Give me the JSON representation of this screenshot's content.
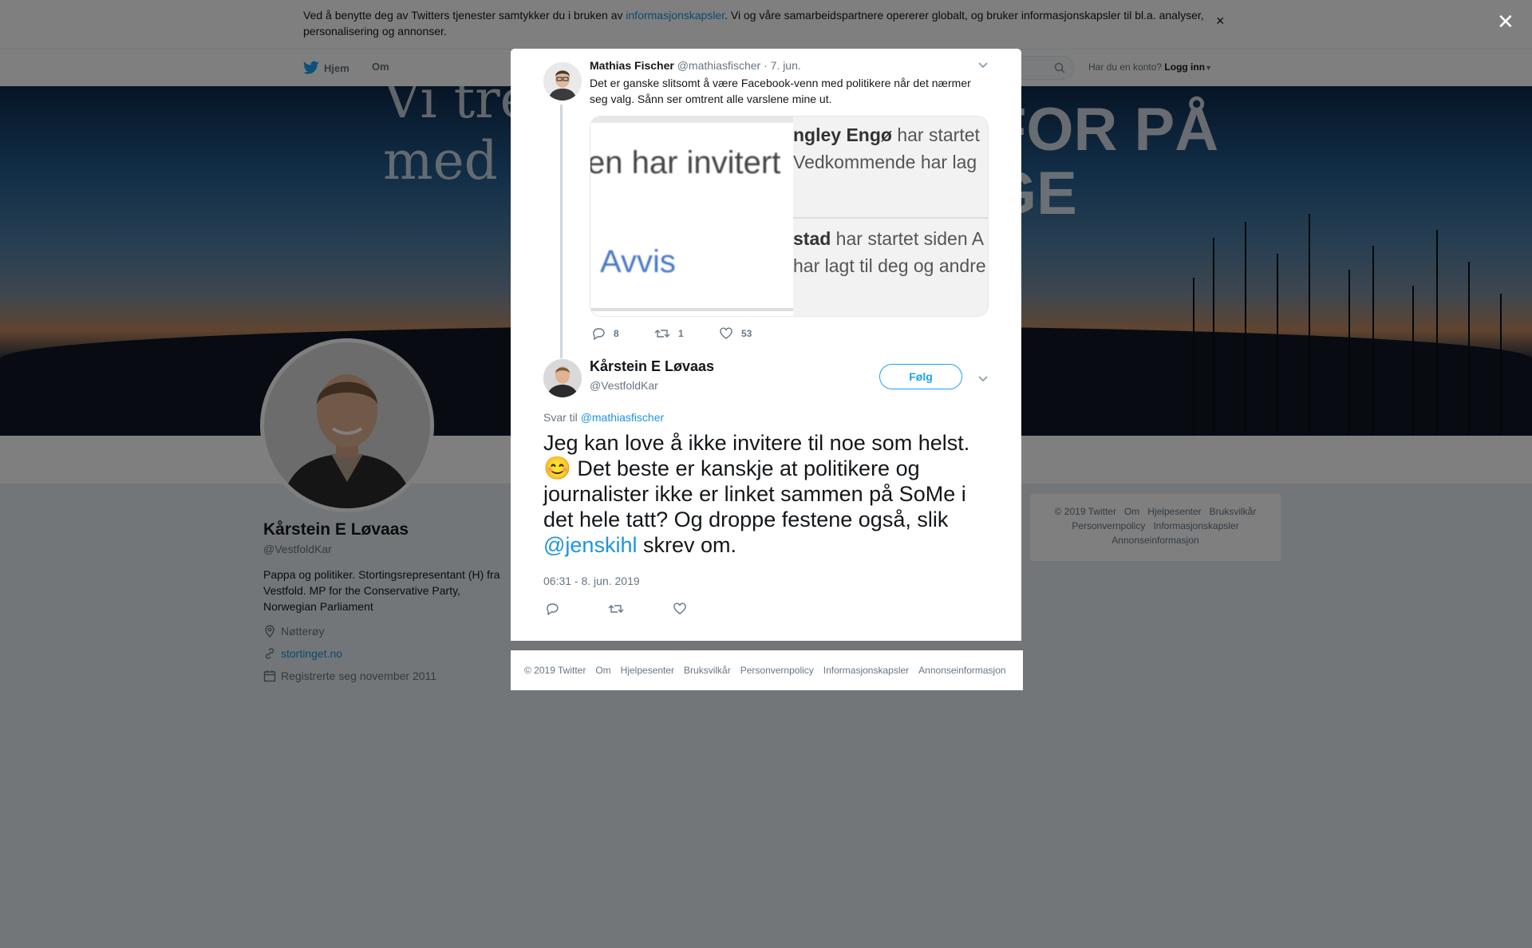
{
  "cookie_banner": {
    "text_before": "Ved å benytte deg av Twitters tjenester samtykker du i bruken av ",
    "link": "informasjonskapsler",
    "text_after": ". Vi og våre samarbeidspartnere opererer globalt, og bruker informasjonskapsler til bl.a. analyser, personalisering og annonser.",
    "close": "×"
  },
  "nav": {
    "home": "Hjem",
    "about": "Om",
    "login_prompt": "Har du en konto?",
    "login": "Logg inn"
  },
  "banner": {
    "text_left_1": "Vi trenger",
    "text_left_2": "med i",
    "text_right_1": "FOR PÅ",
    "text_right_2": "GE"
  },
  "profile": {
    "name": "Kårstein E Løvaas",
    "handle": "@VestfoldKar",
    "bio": "Pappa og politiker. Stortingsrepresentant (H) fra Vestfold. MP for the Conservative Party, Norwegian Parliament",
    "location": "Nøtterøy",
    "website": "stortinget.no",
    "joined": "Registrerte seg november 2011"
  },
  "side_footer": {
    "links": [
      "© 2019 Twitter",
      "Om",
      "Hjelpesenter",
      "Bruksvilkår",
      "Personvernpolicy",
      "Informasjonskapsler",
      "Annonseinformasjon"
    ]
  },
  "overlay": {
    "close": "✕"
  },
  "parent_tweet": {
    "name": "Mathias Fischer",
    "handle": "@mathiasfischer",
    "date": "· 7. jun.",
    "text": "Det er ganske slitsomt å være Facebook-venn med politikere når det nærmer seg valg. Sånn ser omtrent alle varslene mine ut.",
    "media": {
      "left_line1": "en har invitert",
      "left_line2": "Avvis",
      "right_line1_bold": "ngley Engø",
      "right_line1": " har startet",
      "right_line2": "Vedkommende har lag",
      "right_line3_bold": "stad",
      "right_line3": " har startet siden A",
      "right_line4": "har lagt til deg og andre"
    },
    "replies": "8",
    "retweets": "1",
    "likes": "53"
  },
  "main_tweet": {
    "name": "Kårstein E Løvaas",
    "handle": "@VestfoldKar",
    "follow": "Følg",
    "reply_to_label": "Svar til ",
    "reply_to_handle": "@mathiasfischer",
    "text_1": "Jeg kan love å ikke invitere til noe som helst. ",
    "emoji": "😊",
    "text_2": " Det beste er kanskje at politikere og journalister ikke er linket sammen på SoMe i det hele tatt? Og droppe festene også, slik ",
    "mention": "@jenskihl",
    "text_3": " skrev om.",
    "timestamp": "06:31 - 8. jun. 2019"
  },
  "modal_footer": {
    "links": [
      "© 2019 Twitter",
      "Om",
      "Hjelpesenter",
      "Bruksvilkår",
      "Personvernpolicy",
      "Informasjonskapsler",
      "Annonseinformasjon"
    ]
  },
  "colors": {
    "accent": "#1da1f2",
    "link": "#1b95e0",
    "muted": "#657786"
  }
}
